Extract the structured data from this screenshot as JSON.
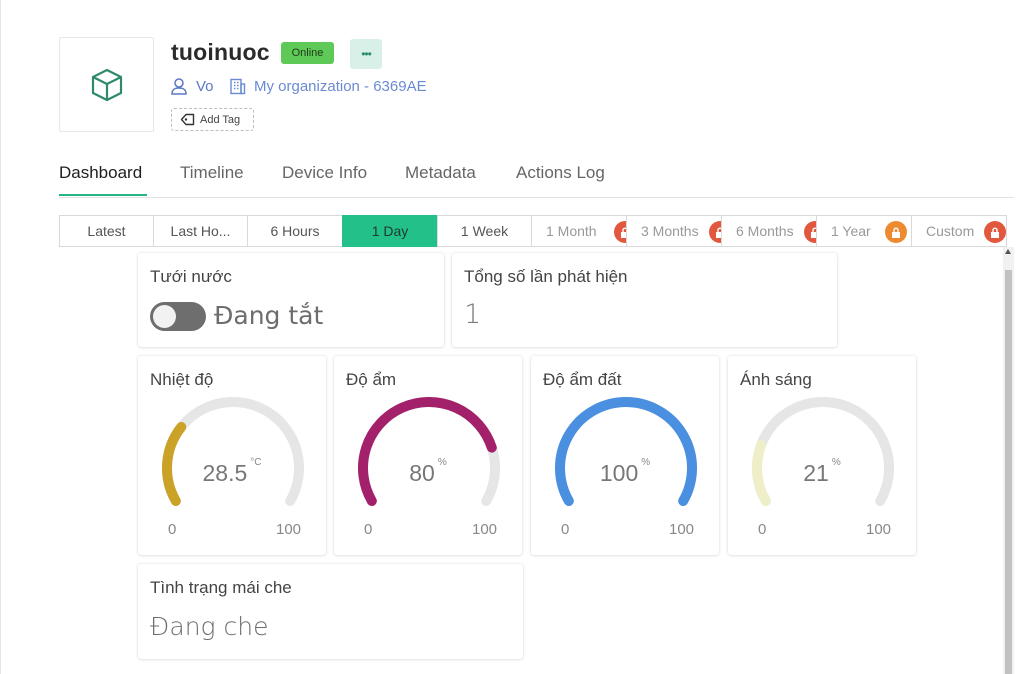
{
  "device": {
    "name": "tuoinuoc",
    "status": "Online",
    "more_label": "•••",
    "owner": "Vo",
    "organization": "My organization - 6369AE",
    "add_tag": "Add Tag"
  },
  "tabs": [
    "Dashboard",
    "Timeline",
    "Device Info",
    "Metadata",
    "Actions Log"
  ],
  "active_tab": "Dashboard",
  "time_ranges": [
    {
      "label": "Latest",
      "locked": false
    },
    {
      "label": "Last Ho...",
      "locked": false
    },
    {
      "label": "6 Hours",
      "locked": false
    },
    {
      "label": "1 Day",
      "locked": false,
      "active": true
    },
    {
      "label": "1 Week",
      "locked": false
    },
    {
      "label": "1 Month",
      "locked": true
    },
    {
      "label": "3 Months",
      "locked": true
    },
    {
      "label": "6 Months",
      "locked": true
    },
    {
      "label": "1 Year",
      "locked": true
    },
    {
      "label": "Custom",
      "locked": true
    }
  ],
  "widgets": {
    "watering": {
      "title": "Tưới nước",
      "state_text": "Đang tắt",
      "on": false
    },
    "detections": {
      "title": "Tổng số lần phát hiện",
      "value": "1"
    },
    "temperature": {
      "title": "Nhiệt độ",
      "value": "28.5",
      "unit": "°C",
      "min": "0",
      "max": "100",
      "fraction": 0.285,
      "color": "#c9a227"
    },
    "humidity": {
      "title": "Độ ẩm",
      "value": "80",
      "unit": "%",
      "min": "0",
      "max": "100",
      "fraction": 0.8,
      "color": "#a3206a"
    },
    "soil_moisture": {
      "title": "Độ ẩm đất",
      "value": "100",
      "unit": "%",
      "min": "0",
      "max": "100",
      "fraction": 1.0,
      "color": "#4a8fe0"
    },
    "light": {
      "title": "Ánh sáng",
      "value": "21",
      "unit": "%",
      "min": "0",
      "max": "100",
      "fraction": 0.21,
      "color": "#eeeec8"
    },
    "roof": {
      "title": "Tình trạng mái che",
      "value": "Đang che"
    }
  },
  "colors": {
    "accent": "#23c08a",
    "online": "#5fc957",
    "gauge_track": "#e6e6e6",
    "lock": "#e2583e"
  }
}
